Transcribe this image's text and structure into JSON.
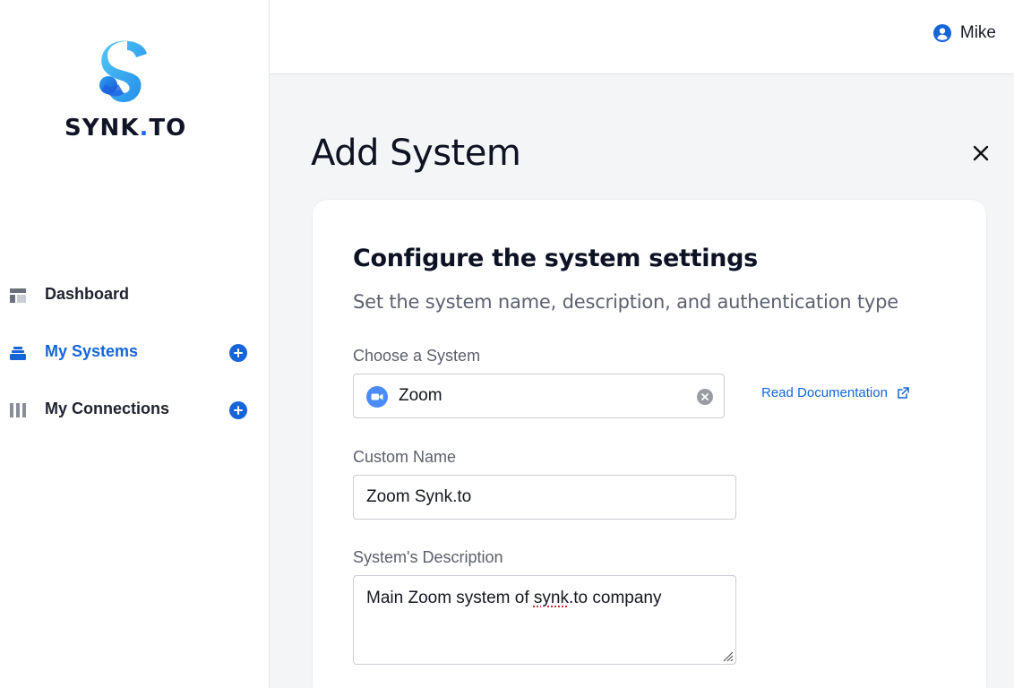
{
  "brand": {
    "name_main": "SYNK",
    "name_dot": ".",
    "name_tld": "TO",
    "accent_color": "#1565d8"
  },
  "sidebar": {
    "items": [
      {
        "label": "Dashboard",
        "icon": "dashboard-icon",
        "active": false,
        "has_add": false
      },
      {
        "label": "My Systems",
        "icon": "stack-icon",
        "active": true,
        "has_add": true
      },
      {
        "label": "My Connections",
        "icon": "columns-icon",
        "active": false,
        "has_add": true
      }
    ]
  },
  "header": {
    "user_name": "Mike",
    "user_icon": "user-circle-icon"
  },
  "page": {
    "title": "Add System",
    "close_icon": "close-icon"
  },
  "card": {
    "title": "Configure the system settings",
    "subtitle": "Set the system name, description, and authentication type",
    "system_select": {
      "label": "Choose a System",
      "value": "Zoom",
      "icon": "zoom-icon",
      "clear_icon": "clear-icon"
    },
    "doc_link": {
      "label": "Read Documentation",
      "icon": "external-link-icon"
    },
    "custom_name": {
      "label": "Custom Name",
      "value": "Zoom Synk.to"
    },
    "description": {
      "label": "System's Description",
      "value_before": "Main Zoom system of ",
      "value_misspelled": "synk",
      "value_after": ".to company"
    }
  }
}
